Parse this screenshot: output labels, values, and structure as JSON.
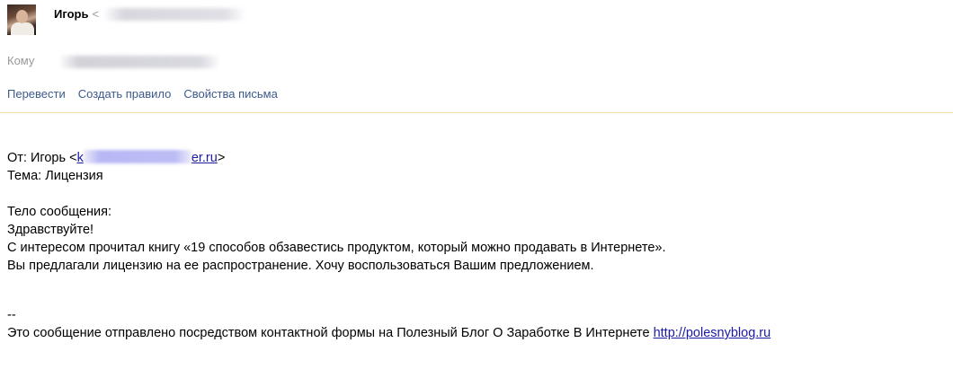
{
  "header": {
    "sender_name": "Игорь",
    "sender_bracket": "<",
    "to_label": "Кому",
    "actions": [
      "Перевести",
      "Создать правило",
      "Свойства письма"
    ]
  },
  "message": {
    "from_prefix": "От: Игорь <",
    "from_email_visible_start": "k",
    "from_email_visible_end": "er.ru",
    "from_suffix": ">",
    "subject_line": "Тема: Лицензия",
    "body_heading": "Тело сообщения:",
    "greeting": "Здравствуйте!",
    "line1": "С интересом прочитал книгу «19 способов обзавестись продуктом, который можно продавать в Интернете».",
    "line2": "Вы предлагали лицензию на ее распространение. Хочу воспользоваться Вашим предложением.",
    "signature_sep": "--",
    "footer_text": "Это сообщение отправлено посредством контактной формы на Полезный Блог О Заработке В Интернете ",
    "footer_link": "http://polesnyblog.ru"
  },
  "colors": {
    "link": "#1a1aa6",
    "action_link": "#3c5a8a",
    "muted": "#999999",
    "divider": "#f3dfb0"
  }
}
